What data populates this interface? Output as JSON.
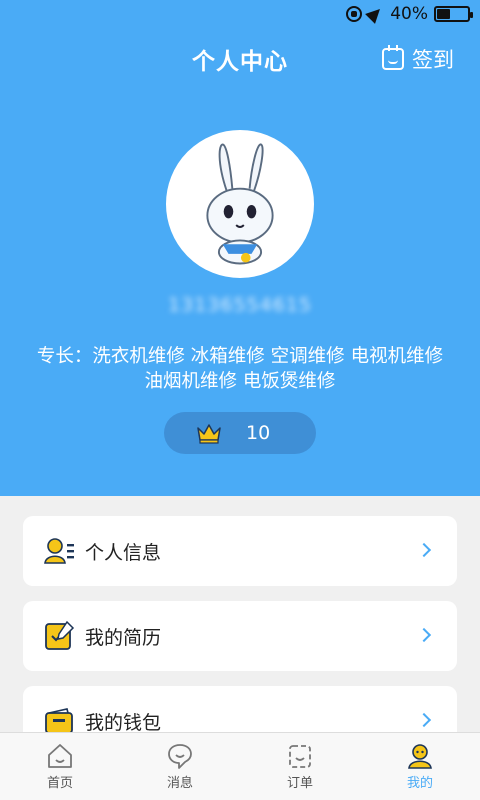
{
  "status_bar": {
    "battery_text": "40%",
    "battery_level": 0.4
  },
  "header": {
    "title": "个人中心",
    "signin_label": "签到",
    "phone": "13136554615",
    "specialty": "专长：洗衣机维修 冰箱维修 空调维修 电视机维修 油烟机维修 电饭煲维修",
    "points": "10"
  },
  "menu": [
    {
      "label": "个人信息",
      "icon": "personal-info-icon"
    },
    {
      "label": "我的简历",
      "icon": "resume-icon"
    },
    {
      "label": "我的钱包",
      "icon": "wallet-icon"
    }
  ],
  "tabs": [
    {
      "label": "首页",
      "icon": "home-icon",
      "active": false
    },
    {
      "label": "消息",
      "icon": "message-icon",
      "active": false
    },
    {
      "label": "订单",
      "icon": "order-icon",
      "active": false
    },
    {
      "label": "我的",
      "icon": "profile-icon",
      "active": true
    }
  ],
  "colors": {
    "primary": "#4aabf6",
    "points_pill": "#3f8fd6",
    "accent_yellow": "#f5c518",
    "background": "#f0f0f0"
  }
}
